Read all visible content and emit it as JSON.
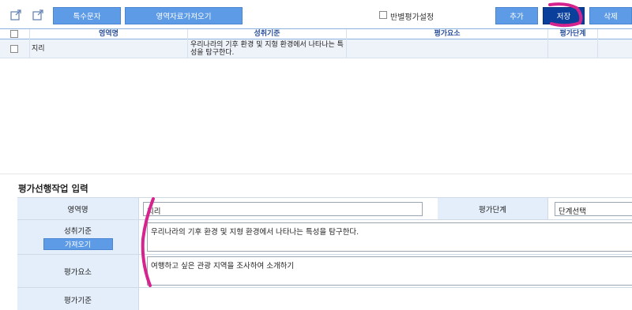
{
  "toolbar": {
    "special_char_label": "특수문자",
    "import_area_label": "영역자료가져오기",
    "class_eval_setting_label": "반별평가설정",
    "add_label": "추가",
    "save_label": "저장",
    "delete_label": "삭제"
  },
  "grid": {
    "headers": [
      "영역명",
      "성취기준",
      "평가요소",
      "평가단계"
    ],
    "rows": [
      {
        "area": "지리",
        "achievement": "우리나라의 기후 환경 및 지형 환경에서 나타나는 특성을 탐구한다.",
        "element": "",
        "stage": ""
      }
    ]
  },
  "section_title": "평가선행작업 입력",
  "form": {
    "area_label": "영역명",
    "area_value": "지리",
    "stage_label": "평가단계",
    "stage_value": "단계선택",
    "achievement_label": "성취기준",
    "fetch_label": "가져오기",
    "achievement_value": "우리나라의 기후 환경 및 지형 환경에서 나타나는 특성을 탐구한다.",
    "element_label": "평가요소",
    "element_value": "여행하고 싶은 관광 지역을 조사하여 소개하기",
    "criteria_label": "평가기준"
  },
  "colors": {
    "button_blue": "#5d9be6",
    "save_dark": "#0b3f9c",
    "header_text": "#2a4f9a",
    "annotation": "#d6248f"
  }
}
